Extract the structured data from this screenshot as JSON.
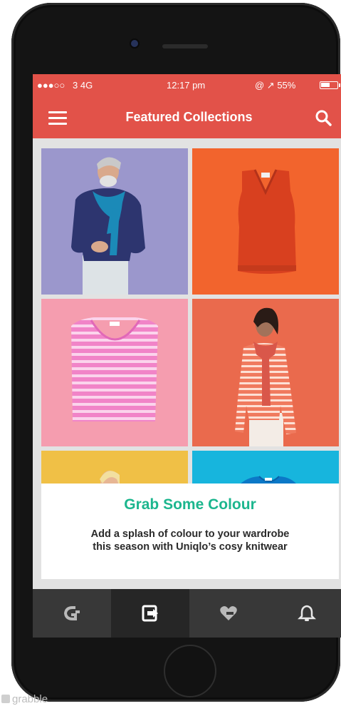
{
  "status_bar": {
    "signal": "●●●○○",
    "carrier": "3  4G",
    "time": "12:17 pm",
    "right": "@ ↗ 55%",
    "battery_level": 0.55
  },
  "app_bar": {
    "title": "Featured Collections",
    "menu_icon": "hamburger-menu-icon",
    "search_icon": "search-icon"
  },
  "grid": {
    "tiles": [
      {
        "subject": "man in blue sweater and scarf",
        "bg": "#9b97cc"
      },
      {
        "subject": "orange knit vest",
        "bg": "#f2642d"
      },
      {
        "subject": "pink striped sweater",
        "bg": "#f59daf"
      },
      {
        "subject": "woman in striped knit sweater",
        "bg": "#ea6a4d"
      },
      {
        "subject": "person on yellow background",
        "bg": "#f0c046"
      },
      {
        "subject": "blue sweater",
        "bg": "#17b5dd"
      }
    ]
  },
  "card": {
    "title": "Grab Some Colour",
    "description_line1": "Add a splash of colour to your wardrobe",
    "description_line2": "this season with Uniqlo’s cosy knitwear"
  },
  "bottom_nav": {
    "items": [
      {
        "icon": "grab-logo-icon",
        "active": false
      },
      {
        "icon": "collections-icon",
        "active": true
      },
      {
        "icon": "heart-hand-icon",
        "active": false
      },
      {
        "icon": "bell-icon",
        "active": false
      }
    ]
  },
  "watermark": {
    "text": "grabble"
  },
  "colors": {
    "brand": "#e25249",
    "accent_green": "#1cb68e",
    "nav_bg": "#383838"
  }
}
